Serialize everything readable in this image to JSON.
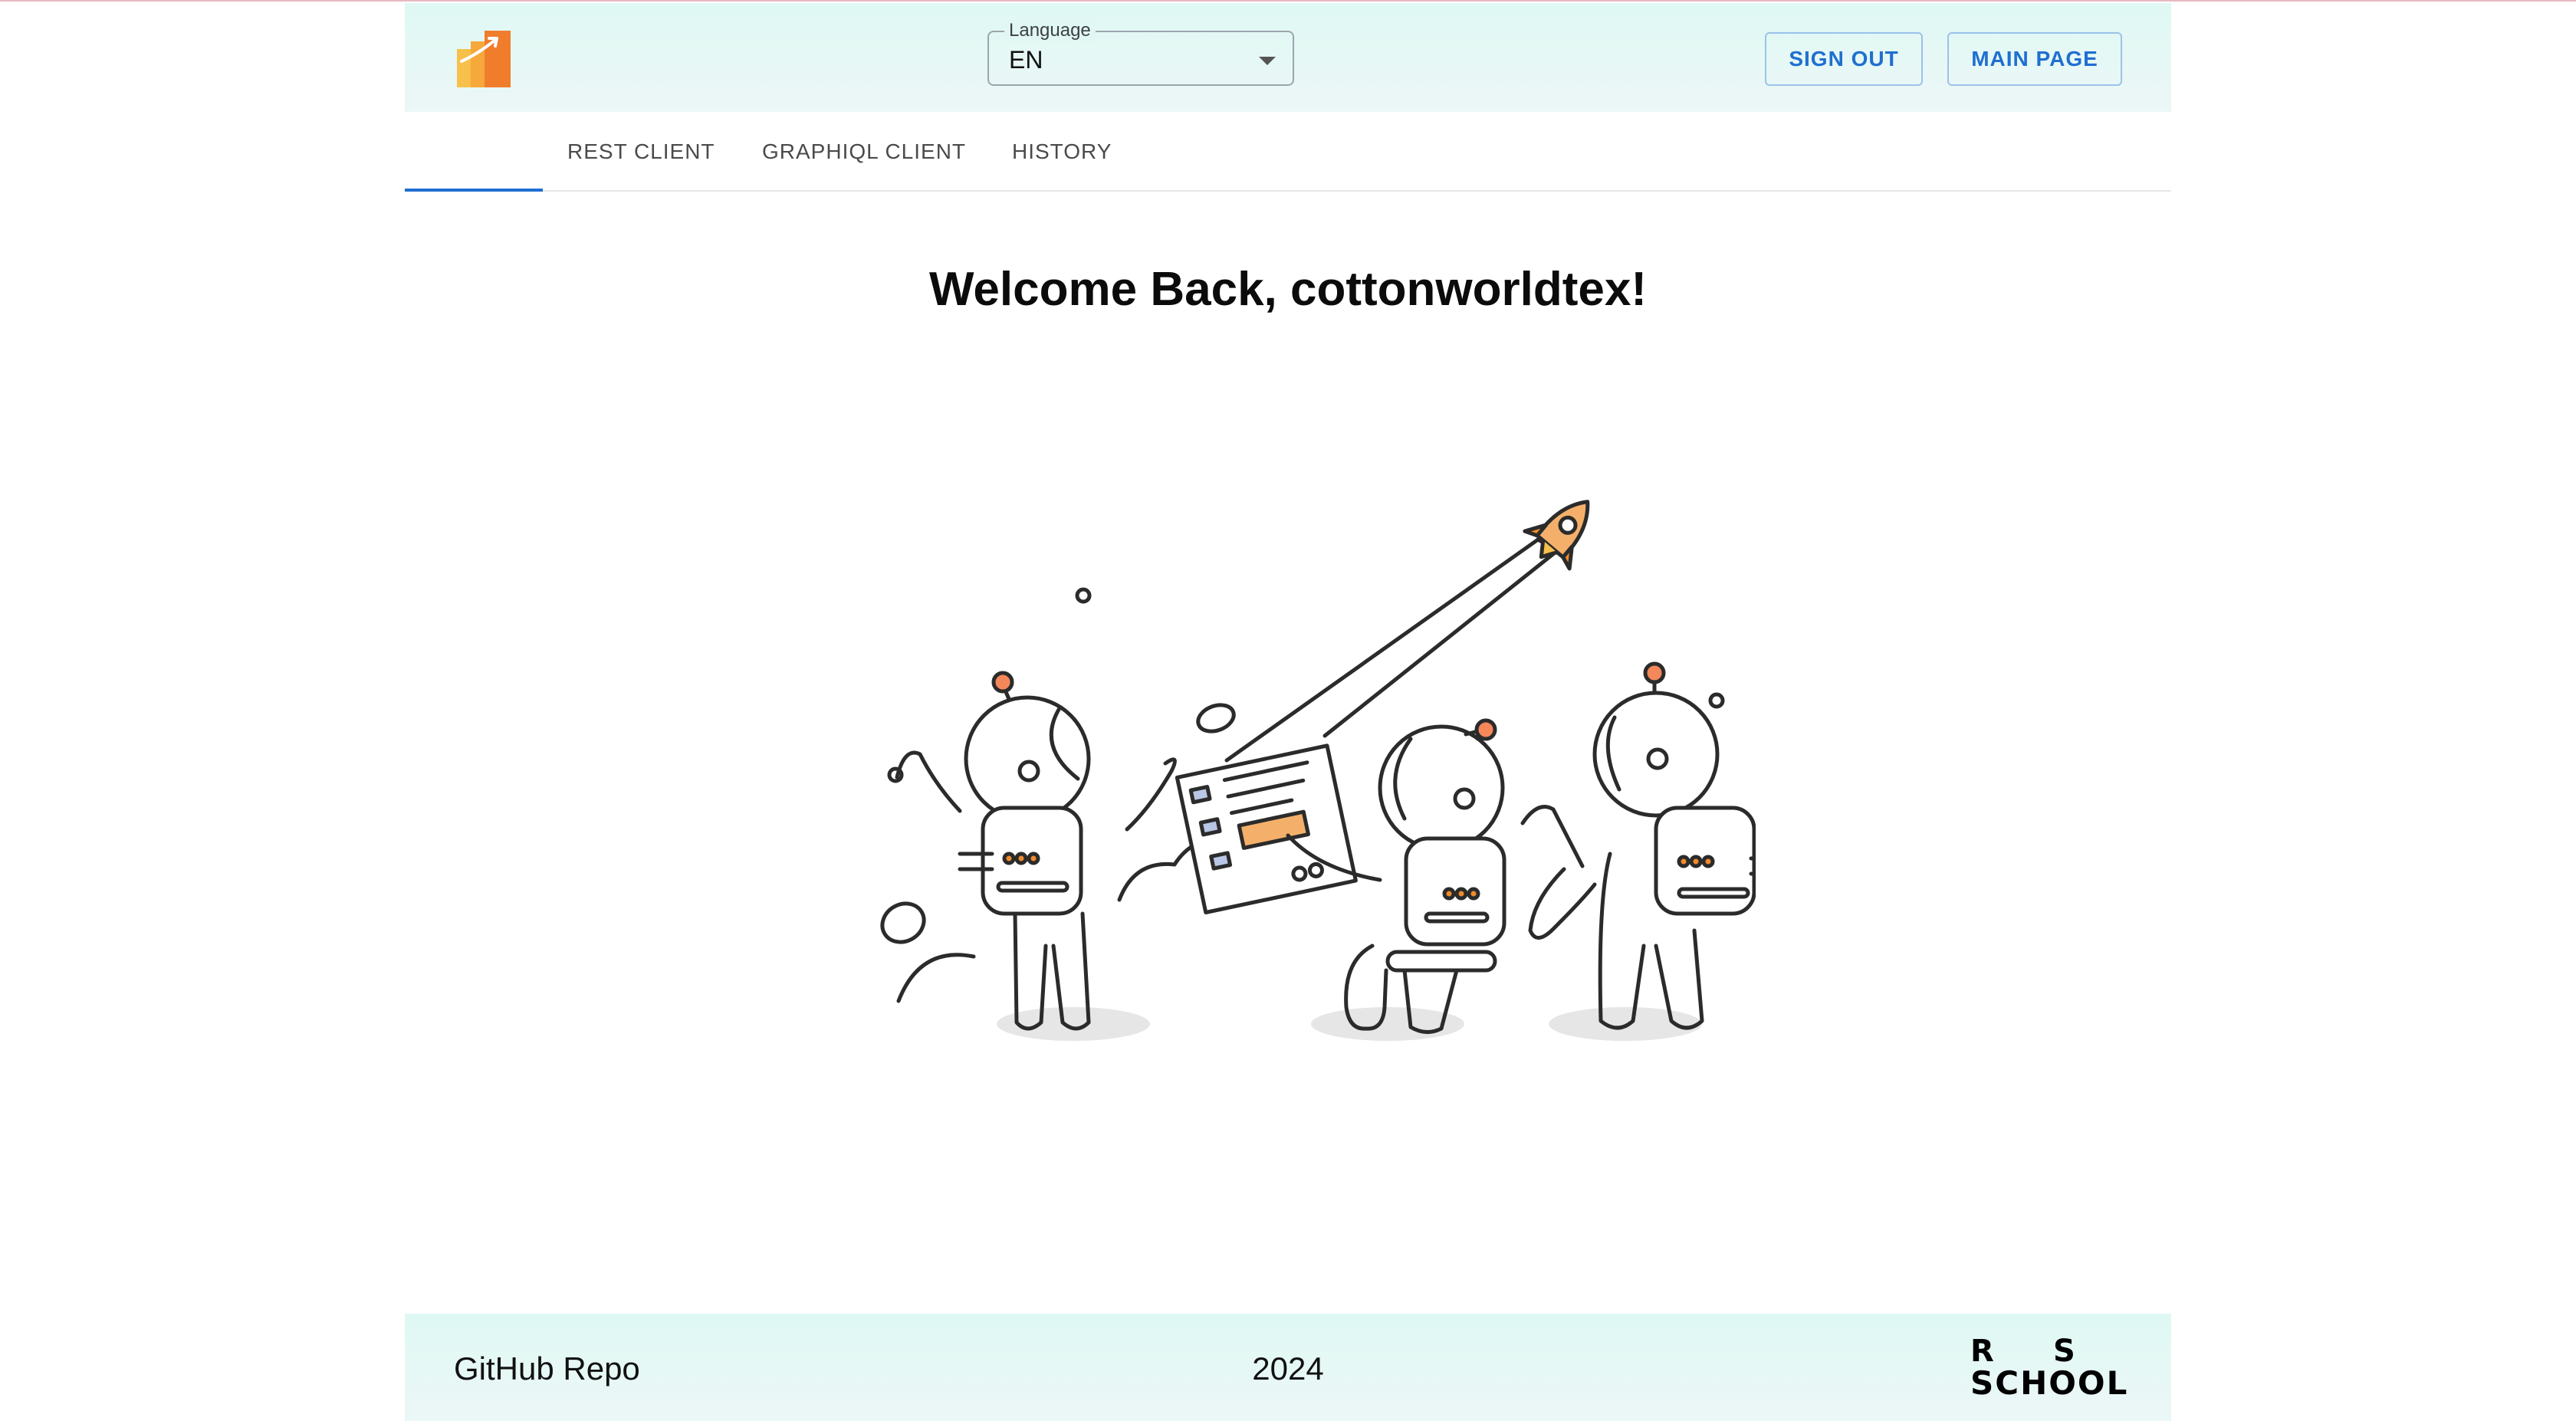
{
  "header": {
    "language_label": "Language",
    "language_value": "EN",
    "sign_out_label": "SIGN OUT",
    "main_page_label": "MAIN PAGE"
  },
  "tabs": [
    {
      "label": "REST CLIENT"
    },
    {
      "label": "GRAPHIQL CLIENT"
    },
    {
      "label": "HISTORY"
    }
  ],
  "main": {
    "welcome_text": "Welcome Back, cottonworldtex!"
  },
  "footer": {
    "github_link": "GitHub Repo",
    "year": "2024",
    "logo_line1_left": "R",
    "logo_line1_right": "S",
    "logo_line2": "SCHOOL"
  },
  "colors": {
    "accent": "#1f6fd1",
    "header_bg": "#dff8f3",
    "logo_orange": "#f08a2c",
    "logo_yellow": "#f6c04a"
  }
}
